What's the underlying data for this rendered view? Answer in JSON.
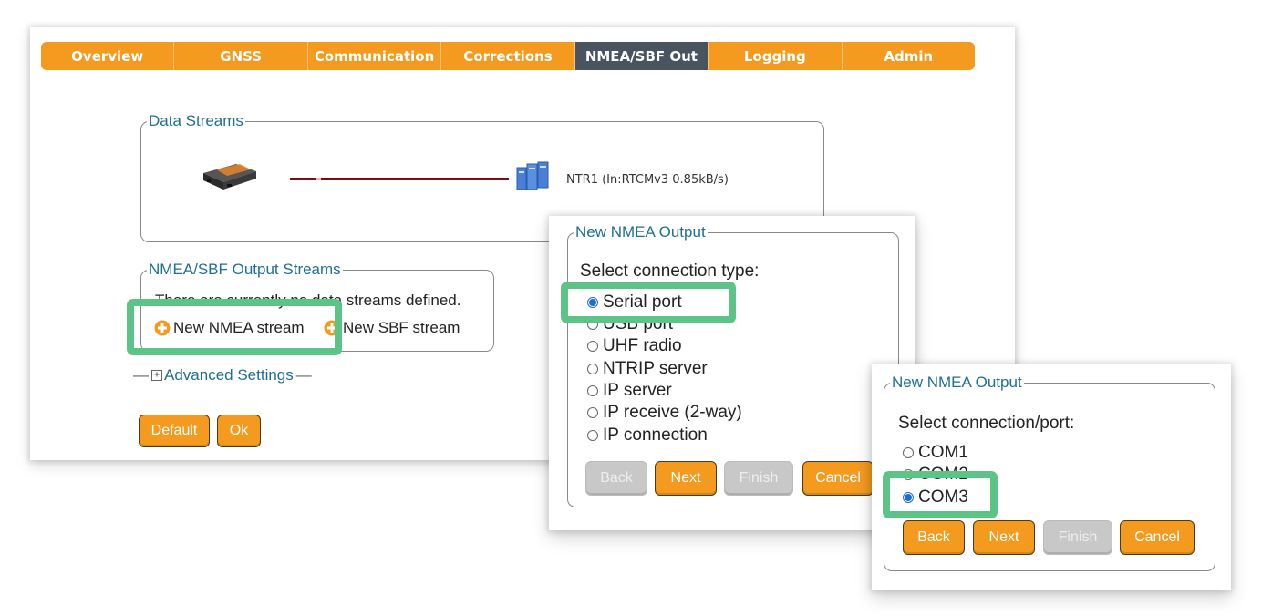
{
  "tabs": [
    {
      "label": "Overview",
      "active": false
    },
    {
      "label": "GNSS",
      "active": false
    },
    {
      "label": "Communication",
      "active": false
    },
    {
      "label": "Corrections",
      "active": false
    },
    {
      "label": "NMEA/SBF Out",
      "active": true
    },
    {
      "label": "Logging",
      "active": false
    },
    {
      "label": "Admin",
      "active": false
    }
  ],
  "data_streams": {
    "legend": "Data Streams",
    "ntr_label": "NTR1 (In:RTCMv3 0.85kB/s)"
  },
  "output_streams": {
    "legend": "NMEA/SBF Output Streams",
    "empty_text": "There are currently no data streams defined.",
    "new_nmea": "New NMEA stream",
    "new_sbf": "New SBF stream"
  },
  "advanced": {
    "label": "Advanced Settings",
    "toggle": "+"
  },
  "main_buttons": {
    "default": "Default",
    "ok": "Ok"
  },
  "dialog1": {
    "legend": "New NMEA Output",
    "prompt": "Select connection type:",
    "options": [
      "Serial port",
      "USB port",
      "UHF radio",
      "NTRIP server",
      "IP server",
      "IP receive (2-way)",
      "IP connection"
    ],
    "selected": "Serial port",
    "buttons": {
      "back": "Back",
      "next": "Next",
      "finish": "Finish",
      "cancel": "Cancel"
    }
  },
  "dialog2": {
    "legend": "New NMEA Output",
    "prompt": "Select connection/port:",
    "options": [
      "COM1",
      "COM2",
      "COM3"
    ],
    "selected": "COM3",
    "buttons": {
      "back": "Back",
      "next": "Next",
      "finish": "Finish",
      "cancel": "Cancel"
    }
  },
  "colors": {
    "accent": "#f39a1f",
    "active_tab": "#4a5460",
    "highlight": "#5cc487",
    "legend": "#1f6f95",
    "link_line": "#7a0e10"
  }
}
